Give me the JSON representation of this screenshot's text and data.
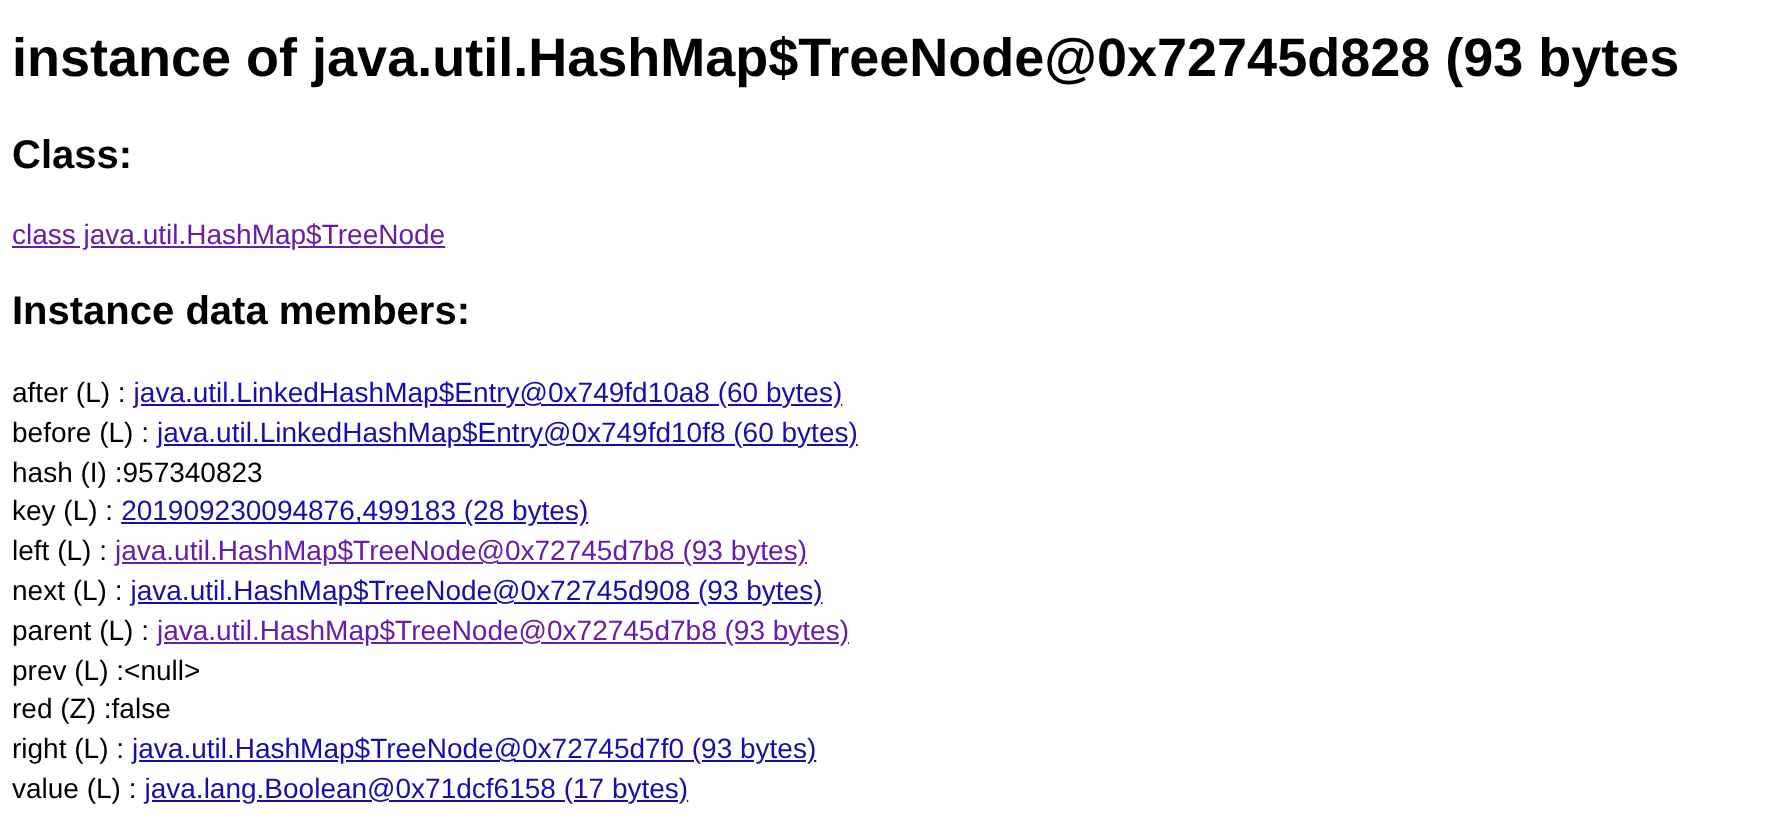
{
  "title": "instance of java.util.HashMap$TreeNode@0x72745d828 (93 bytes",
  "class_section": {
    "heading": "Class:",
    "link": {
      "text": "class java.util.HashMap$TreeNode",
      "visited": true
    }
  },
  "members_section": {
    "heading": "Instance data members:",
    "members": [
      {
        "label": "after (L) :",
        "kind": "link",
        "value": "java.util.LinkedHashMap$Entry@0x749fd10a8 (60 bytes)",
        "visited": false
      },
      {
        "label": "before (L) :",
        "kind": "link",
        "value": "java.util.LinkedHashMap$Entry@0x749fd10f8 (60 bytes)",
        "visited": false
      },
      {
        "label": "hash (I) :",
        "kind": "text",
        "value": "957340823"
      },
      {
        "label": "key (L) :",
        "kind": "link",
        "value": "201909230094876,499183 (28 bytes)",
        "visited": false
      },
      {
        "label": "left (L) :",
        "kind": "link",
        "value": "java.util.HashMap$TreeNode@0x72745d7b8 (93 bytes)",
        "visited": true
      },
      {
        "label": "next (L) :",
        "kind": "link",
        "value": "java.util.HashMap$TreeNode@0x72745d908 (93 bytes)",
        "visited": false
      },
      {
        "label": "parent (L) :",
        "kind": "link",
        "value": "java.util.HashMap$TreeNode@0x72745d7b8 (93 bytes)",
        "visited": true
      },
      {
        "label": "prev (L) :",
        "kind": "text",
        "value": "<null>"
      },
      {
        "label": "red (Z) :",
        "kind": "text",
        "value": "false"
      },
      {
        "label": "right (L) :",
        "kind": "link",
        "value": "java.util.HashMap$TreeNode@0x72745d7f0 (93 bytes)",
        "visited": false
      },
      {
        "label": "value (L) :",
        "kind": "link",
        "value": "java.lang.Boolean@0x71dcf6158 (17 bytes)",
        "visited": false
      }
    ]
  }
}
